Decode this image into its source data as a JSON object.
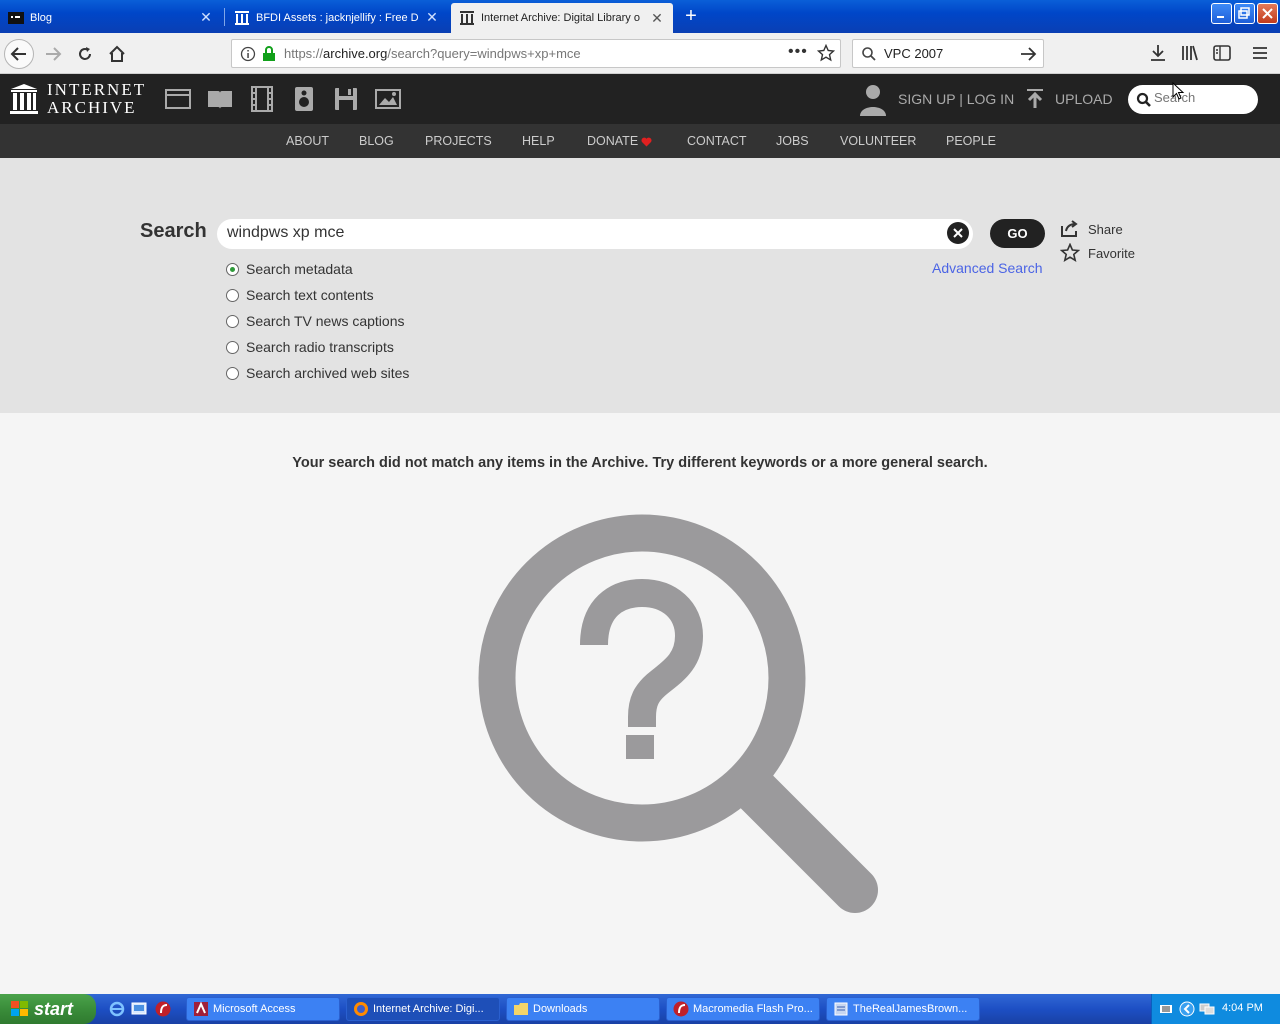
{
  "browser": {
    "tabs": [
      {
        "title": "Blog",
        "active": false
      },
      {
        "title": "BFDI Assets : jacknjellify : Free D",
        "active": false
      },
      {
        "title": "Internet Archive: Digital Library o",
        "active": true
      }
    ],
    "url_prefix": "https://",
    "url_host": "archive.org",
    "url_path": "/search?query=windpws+xp+mce",
    "search_value": "VPC 2007"
  },
  "ia": {
    "logo_line1": "INTERNET",
    "logo_line2": "ARCHIVE",
    "signup_login": "SIGN UP | LOG IN",
    "upload": "UPLOAD",
    "search_placeholder": "Search",
    "nav": [
      "ABOUT",
      "BLOG",
      "PROJECTS",
      "HELP",
      "DONATE",
      "CONTACT",
      "JOBS",
      "VOLUNTEER",
      "PEOPLE"
    ]
  },
  "search": {
    "label": "Search",
    "query": "windpws xp mce",
    "go": "GO",
    "options": [
      {
        "label": "Search metadata",
        "checked": true
      },
      {
        "label": "Search text contents",
        "checked": false
      },
      {
        "label": "Search TV news captions",
        "checked": false
      },
      {
        "label": "Search radio transcripts",
        "checked": false
      },
      {
        "label": "Search archived web sites",
        "checked": false
      }
    ],
    "advanced": "Advanced Search",
    "share": "Share",
    "favorite": "Favorite"
  },
  "results": {
    "message": "Your search did not match any items in the Archive. Try different keywords or a more general search."
  },
  "taskbar": {
    "start": "start",
    "items": [
      {
        "label": "Microsoft Access",
        "icon": "access-icon"
      },
      {
        "label": "Internet Archive: Digi...",
        "icon": "firefox-icon"
      },
      {
        "label": "Downloads",
        "icon": "folder-icon"
      },
      {
        "label": "Macromedia Flash Pro...",
        "icon": "flash-icon"
      },
      {
        "label": "TheRealJamesBrown...",
        "icon": "app-icon"
      }
    ],
    "clock": "4:04 PM"
  },
  "colors": {
    "ia_dark": "#222222",
    "ia_sub": "#333333",
    "search_bg": "#e3e3e3",
    "link_blue": "#4b64e5",
    "radio_green": "#2f9a3a",
    "donate_heart": "#e02020"
  }
}
